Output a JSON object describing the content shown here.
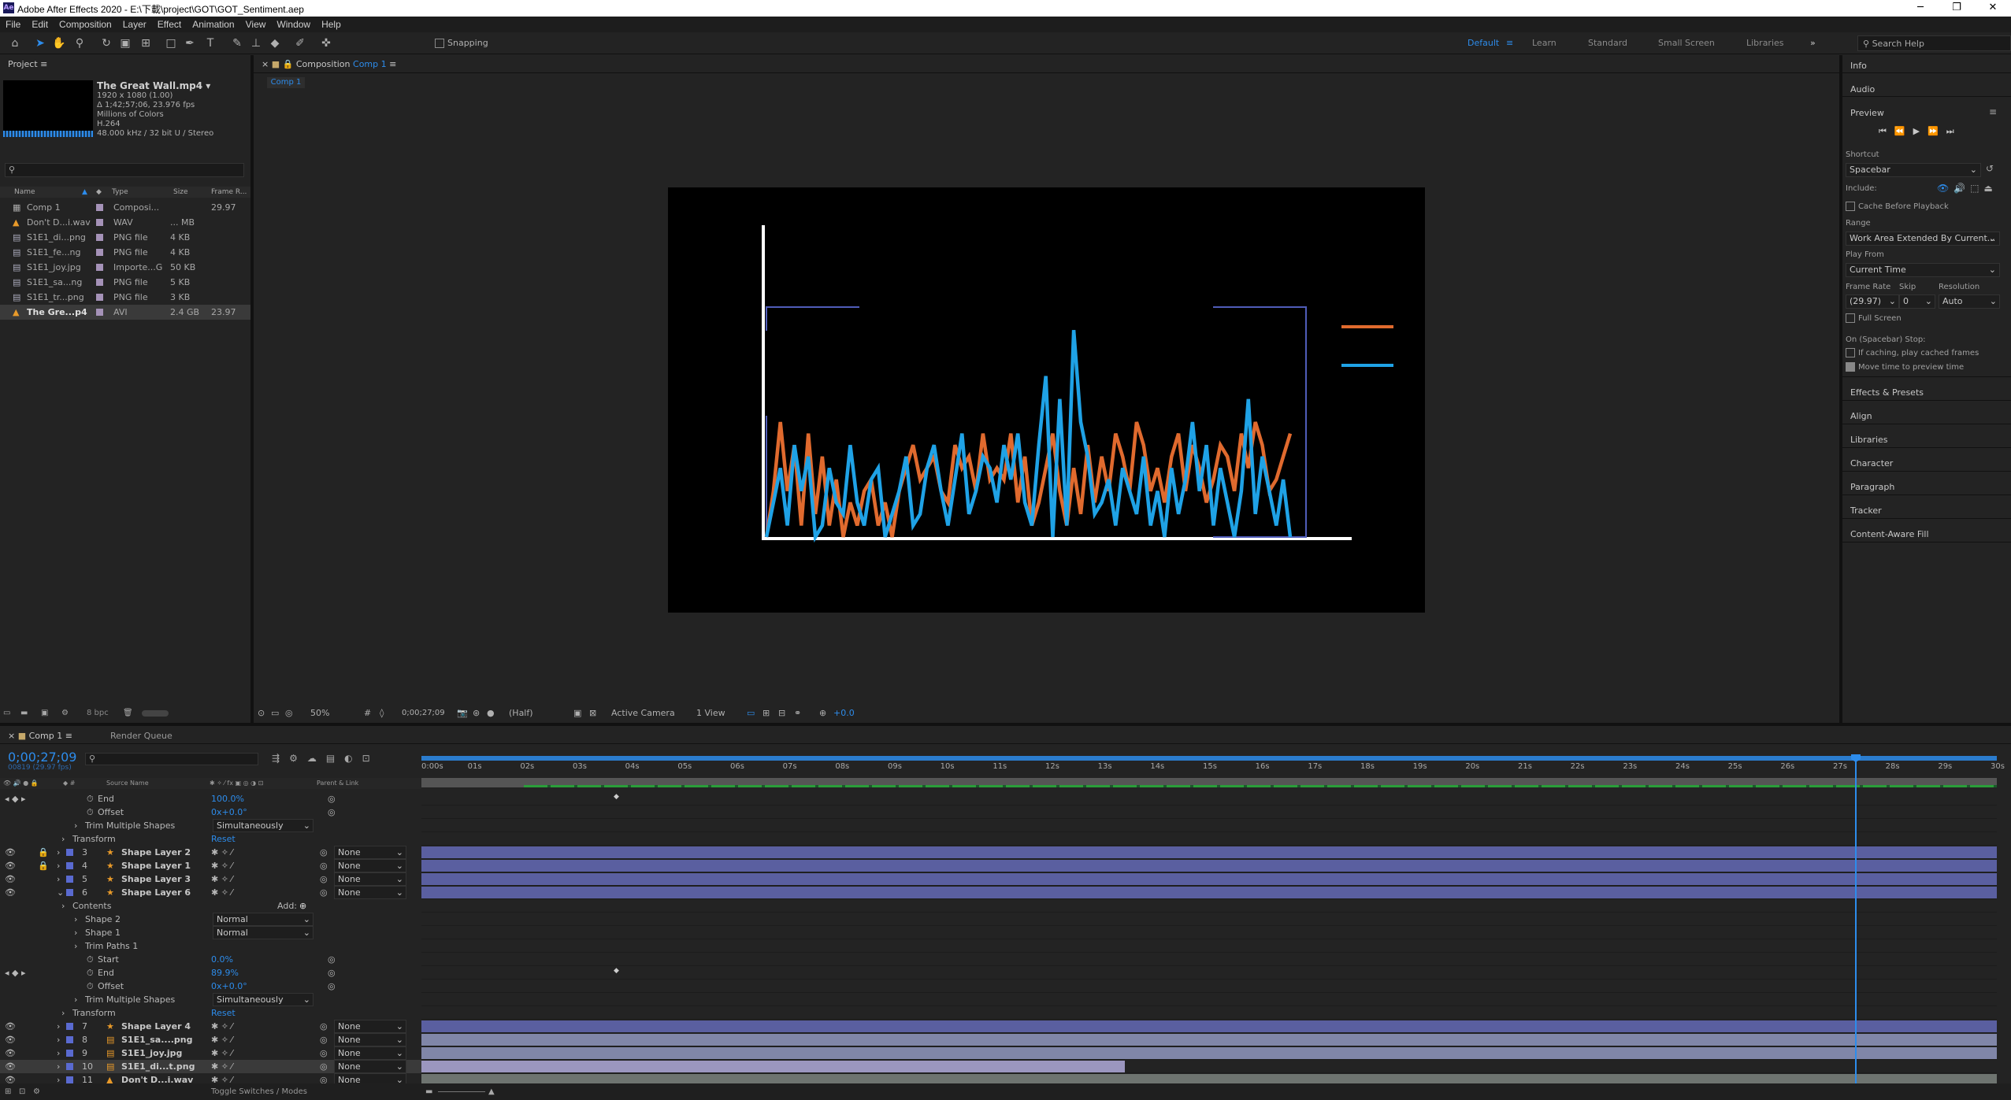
{
  "app": {
    "logo": "Ae",
    "title": "Adobe After Effects 2020 - E:\\下載\\project\\GOT\\GOT_Sentiment.aep",
    "window_controls": [
      "─",
      "❐",
      "✕"
    ]
  },
  "menu": [
    "File",
    "Edit",
    "Composition",
    "Layer",
    "Effect",
    "Animation",
    "View",
    "Window",
    "Help"
  ],
  "toolbar": {
    "snapping_label": "Snapping",
    "workspaces": [
      "Default",
      "Learn",
      "Standard",
      "Small Screen",
      "Libraries"
    ],
    "more": "»",
    "search_placeholder": "Search Help"
  },
  "project": {
    "tab": "Project",
    "footage_name": "The Great Wall.mp4 ▾",
    "footage_info": [
      "1920 x 1080 (1.00)",
      "Δ 1;42;57;06, 23.976 fps",
      "Millions of Colors",
      "H.264",
      "48.000 kHz / 32 bit U / Stereo"
    ],
    "columns": [
      "Name",
      "Type",
      "Size",
      "Frame R..."
    ],
    "items": [
      {
        "name": "Comp 1",
        "type": "Composi...",
        "size": "",
        "fr": "29.97",
        "color": "#a592b8",
        "icon": "comp"
      },
      {
        "name": "Don't D...i.wav",
        "type": "WAV",
        "size": "... MB",
        "fr": "",
        "color": "#a592b8",
        "icon": "audio"
      },
      {
        "name": "S1E1_di...png",
        "type": "PNG file",
        "size": "4 KB",
        "fr": "",
        "color": "#a592b8",
        "icon": "image"
      },
      {
        "name": "S1E1_fe...ng",
        "type": "PNG file",
        "size": "4 KB",
        "fr": "",
        "color": "#a592b8",
        "icon": "image"
      },
      {
        "name": "S1E1_joy.jpg",
        "type": "Importe...G",
        "size": "50 KB",
        "fr": "",
        "color": "#a592b8",
        "icon": "image"
      },
      {
        "name": "S1E1_sa...ng",
        "type": "PNG file",
        "size": "5 KB",
        "fr": "",
        "color": "#a592b8",
        "icon": "image"
      },
      {
        "name": "S1E1_tr...png",
        "type": "PNG file",
        "size": "3 KB",
        "fr": "",
        "color": "#a592b8",
        "icon": "image"
      },
      {
        "name": "The Gre...p4",
        "type": "AVI",
        "size": "2.4 GB",
        "fr": "23.97",
        "color": "#a592b8",
        "icon": "video"
      }
    ],
    "bpc": "8 bpc"
  },
  "composition": {
    "tab_prefix": "Composition",
    "tab_name": "Comp 1",
    "flow_label": "Comp 1",
    "footer": {
      "zoom": "50%",
      "timecode": "0;00;27;09",
      "resolution": "(Half)",
      "camera": "Active Camera",
      "views": "1 View",
      "exposure": "+0.0"
    }
  },
  "right_panels": {
    "info": "Info",
    "audio": "Audio",
    "preview": "Preview",
    "shortcut_label": "Shortcut",
    "shortcut_value": "Spacebar",
    "include_label": "Include:",
    "cache_label": "Cache Before Playback",
    "range_label": "Range",
    "range_value": "Work Area Extended By Current...",
    "play_from_label": "Play From",
    "play_from_value": "Current Time",
    "frame_rate_label": "Frame Rate",
    "frame_rate_value": "(29.97)",
    "skip_label": "Skip",
    "skip_value": "0",
    "resolution_label": "Resolution",
    "resolution_value": "Auto",
    "full_screen_label": "Full Screen",
    "stop_label": "On (Spacebar) Stop:",
    "if_caching_label": "If caching, play cached frames",
    "move_time_label": "Move time to preview time",
    "collapsed": [
      "Effects & Presets",
      "Align",
      "Libraries",
      "Character",
      "Paragraph",
      "Tracker",
      "Content-Aware Fill"
    ]
  },
  "timeline": {
    "tab": "Comp 1",
    "render_queue": "Render Queue",
    "current_time": "0;00;27;09",
    "current_frames": "00819 (29.97 fps)",
    "col_source": "Source Name",
    "col_parent": "Parent & Link",
    "ruler": [
      "0:00s",
      "01s",
      "02s",
      "03s",
      "04s",
      "05s",
      "06s",
      "07s",
      "08s",
      "09s",
      "10s",
      "11s",
      "12s",
      "13s",
      "14s",
      "15s",
      "16s",
      "17s",
      "18s",
      "19s",
      "20s",
      "21s",
      "22s",
      "23s",
      "24s",
      "25s",
      "26s",
      "27s",
      "28s",
      "29s",
      "30s"
    ],
    "rows": [
      {
        "kind": "prop",
        "indent": 2,
        "label": "End",
        "value": "100.0%",
        "key": true
      },
      {
        "kind": "prop",
        "indent": 2,
        "label": "Offset",
        "value": "0x+0.0°"
      },
      {
        "kind": "prop",
        "indent": 1,
        "label": "Trim Multiple Shapes",
        "dropdown": "Simultaneously"
      },
      {
        "kind": "prop",
        "indent": 0,
        "label": "Transform",
        "value": "Reset"
      },
      {
        "kind": "layer",
        "num": "3",
        "name": "Shape Layer 2",
        "parent": "None",
        "bar": "shape",
        "locked": true
      },
      {
        "kind": "layer",
        "num": "4",
        "name": "Shape Layer 1",
        "parent": "None",
        "bar": "shape",
        "locked": true
      },
      {
        "kind": "layer",
        "num": "5",
        "name": "Shape Layer 3",
        "parent": "None",
        "bar": "shape"
      },
      {
        "kind": "layer",
        "num": "6",
        "name": "Shape Layer 6",
        "parent": "None",
        "bar": "shape",
        "open": true
      },
      {
        "kind": "prop",
        "indent": 0,
        "label": "Contents",
        "value": "Add:"
      },
      {
        "kind": "prop",
        "indent": 1,
        "label": "Shape 2",
        "dropdown": "Normal"
      },
      {
        "kind": "prop",
        "indent": 1,
        "label": "Shape 1",
        "dropdown": "Normal"
      },
      {
        "kind": "prop",
        "indent": 1,
        "label": "Trim Paths 1"
      },
      {
        "kind": "prop",
        "indent": 2,
        "label": "Start",
        "value": "0.0%"
      },
      {
        "kind": "prop",
        "indent": 2,
        "label": "End",
        "value": "89.9%",
        "key": true
      },
      {
        "kind": "prop",
        "indent": 2,
        "label": "Offset",
        "value": "0x+0.0°"
      },
      {
        "kind": "prop",
        "indent": 1,
        "label": "Trim Multiple Shapes",
        "dropdown": "Simultaneously"
      },
      {
        "kind": "prop",
        "indent": 0,
        "label": "Transform",
        "value": "Reset"
      },
      {
        "kind": "layer",
        "num": "7",
        "name": "Shape Layer 4",
        "parent": "None",
        "bar": "shape"
      },
      {
        "kind": "layer",
        "num": "8",
        "name": "S1E1_sa....png",
        "parent": "None",
        "bar": "image"
      },
      {
        "kind": "layer",
        "num": "9",
        "name": "S1E1_joy.jpg",
        "parent": "None",
        "bar": "image"
      },
      {
        "kind": "layer",
        "num": "10",
        "name": "S1E1_di...t.png",
        "parent": "None",
        "bar": "image_short",
        "selected": true
      },
      {
        "kind": "layer",
        "num": "11",
        "name": "Don't D...i.wav",
        "parent": "None",
        "bar": "audio"
      }
    ],
    "toggle_label": "Toggle Switches / Modes",
    "playhead_time": 27.3,
    "duration": 30
  },
  "chart_data": {
    "type": "line",
    "title": "",
    "xlabel": "",
    "ylabel": "",
    "x": [
      0,
      1,
      2,
      3,
      4,
      5,
      6,
      7,
      8,
      9,
      10,
      11,
      12,
      13,
      14,
      15,
      16,
      17,
      18,
      19,
      20,
      21,
      22,
      23,
      24,
      25,
      26,
      27,
      28,
      29,
      30,
      31,
      32,
      33,
      34,
      35,
      36,
      37,
      38,
      39,
      40,
      41,
      42,
      43,
      44,
      45,
      46,
      47,
      48,
      49,
      50,
      51,
      52,
      53,
      54,
      55,
      56,
      57,
      58,
      59,
      60,
      61,
      62,
      63,
      64,
      65,
      66,
      67,
      68,
      69,
      70,
      71,
      72,
      73,
      74,
      75
    ],
    "series": [
      {
        "color": "#e06a2e",
        "values": [
          0,
          0.2,
          0.5,
          0.2,
          0.4,
          0.05,
          0.45,
          0.1,
          0.35,
          0.05,
          0.25,
          0.0,
          0.15,
          0.05,
          0.2,
          0.25,
          0.05,
          0.15,
          0.0,
          0.2,
          0.3,
          0.4,
          0.25,
          0.3,
          0.35,
          0.2,
          0.15,
          0.4,
          0.3,
          0.35,
          0.2,
          0.45,
          0.25,
          0.3,
          0.25,
          0.45,
          0.15,
          0.35,
          0.05,
          0.15,
          0.3,
          0.45,
          0.2,
          0.05,
          0.3,
          0.1,
          0.4,
          0.15,
          0.35,
          0.2,
          0.45,
          0.35,
          0.2,
          0.5,
          0.4,
          0.2,
          0.3,
          0.15,
          0.35,
          0.45,
          0.2,
          0.4,
          0.3,
          0.15,
          0.25,
          0.4,
          0.35,
          0.2,
          0.45,
          0.3,
          0.5,
          0.4,
          0.2,
          0.25,
          0.35,
          0.45
        ]
      },
      {
        "color": "#1fa2e6",
        "values": [
          0,
          0.15,
          0.3,
          0.05,
          0.4,
          0.2,
          0.35,
          0.0,
          0.05,
          0.3,
          0.15,
          0.1,
          0.4,
          0.15,
          0.05,
          0.25,
          0.3,
          0.0,
          0.1,
          0.2,
          0.35,
          0.05,
          0.1,
          0.3,
          0.4,
          0.2,
          0.05,
          0.25,
          0.45,
          0.1,
          0.2,
          0.35,
          0.3,
          0.15,
          0.4,
          0.25,
          0.45,
          0.15,
          0.05,
          0.4,
          0.7,
          0.0,
          0.6,
          0.05,
          0.9,
          0.5,
          0.35,
          0.1,
          0.15,
          0.25,
          0.05,
          0.3,
          0.2,
          0.1,
          0.35,
          0.05,
          0.2,
          0.0,
          0.3,
          0.1,
          0.25,
          0.5,
          0.2,
          0.4,
          0.05,
          0.3,
          0.15,
          0.0,
          0.2,
          0.6,
          0.1,
          0.35,
          0.2,
          0.05,
          0.25,
          0.0
        ]
      }
    ]
  }
}
